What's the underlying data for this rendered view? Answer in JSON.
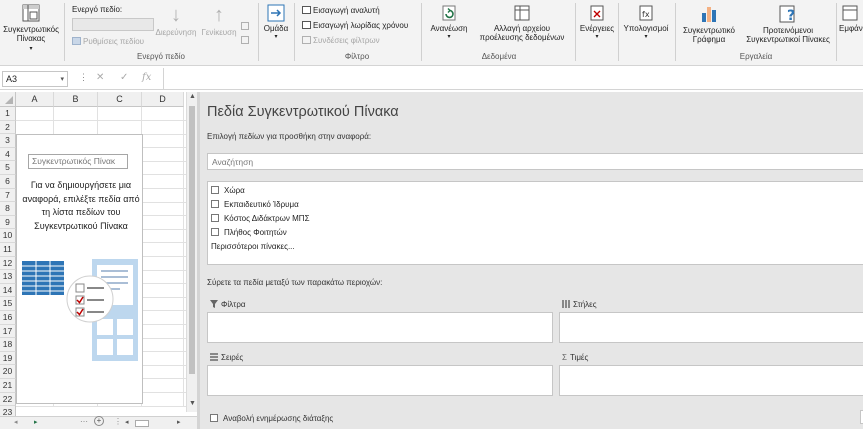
{
  "ribbon": {
    "pivot_table_btn": "Συγκεντρωτικός Πίνακας",
    "active_field": {
      "label": "Ενεργό πεδίο:",
      "field_settings": "Ρυθμίσεις πεδίου",
      "drill_down": "Διερεύνηση",
      "drill_up": "Γενίκευση",
      "group_label": "Ενεργό πεδίο"
    },
    "group_btn": "Ομάδα",
    "filter": {
      "insert_slicer": "Εισαγωγή αναλυτή",
      "insert_timeline": "Εισαγωγή λωρίδας χρόνου",
      "filter_connections": "Συνδέσεις φίλτρων",
      "group_label": "Φίλτρο"
    },
    "data": {
      "refresh": "Ανανέωση",
      "change_source": "Αλλαγή αρχείου προέλευσης δεδομένων",
      "group_label": "Δεδομένα"
    },
    "actions_btn": "Ενέργειες",
    "calculations_btn": "Υπολογισμοί",
    "tools": {
      "pivot_chart": "Συγκεντρωτικό Γράφημα",
      "recommended": "Προτεινόμενοι Συγκεντρωτικοί Πίνακες",
      "group_label": "Εργαλεία"
    },
    "show_btn": "Εμφάνιση"
  },
  "formula_bar": {
    "name_box": "A3",
    "cancel_icon": "✕",
    "enter_icon": "✓",
    "fx_icon": "fx"
  },
  "sheet": {
    "columns": [
      "A",
      "B",
      "C",
      "D"
    ],
    "rows": [
      "1",
      "2",
      "3",
      "4",
      "5",
      "6",
      "7",
      "8",
      "9",
      "10",
      "11",
      "12",
      "13",
      "14",
      "15",
      "16",
      "17",
      "18",
      "19",
      "20",
      "21",
      "22",
      "23"
    ],
    "pivot_name": "Συγκεντρωτικός Πίνακ",
    "pivot_message": "Για να δημιουργήσετε μια αναφορά, επιλέξτε πεδία από τη λίστα πεδίων του Συγκεντρωτικού Πίνακα"
  },
  "pane": {
    "title": "Πεδία Συγκεντρωτικού Πίνακα",
    "subtitle": "Επιλογή πεδίων για προσθήκη στην αναφορά:",
    "search_placeholder": "Αναζήτηση",
    "fields": [
      "Χώρα",
      "Εκπαιδευτικό Ίδρυμα",
      "Κόστος Διδάκτρων ΜΠΣ",
      "Πλήθος Φοιτητών"
    ],
    "more_tables": "Περισσότεροι πίνακες...",
    "drag_hint": "Σύρετε τα πεδία μεταξύ των παρακάτω περιοχών:",
    "areas": {
      "filters": "Φίλτρα",
      "columns": "Στήλες",
      "rows": "Σειρές",
      "values": "Τιμές"
    },
    "defer_update": "Αναβολή ενημέρωσης διάταξης"
  },
  "colors": {
    "excel_green": "#217346",
    "ribbon_bg": "#f3f3f3",
    "pane_bg": "#e6e6e6",
    "blue_icon": "#2e75b6",
    "red_check": "#c00000"
  }
}
